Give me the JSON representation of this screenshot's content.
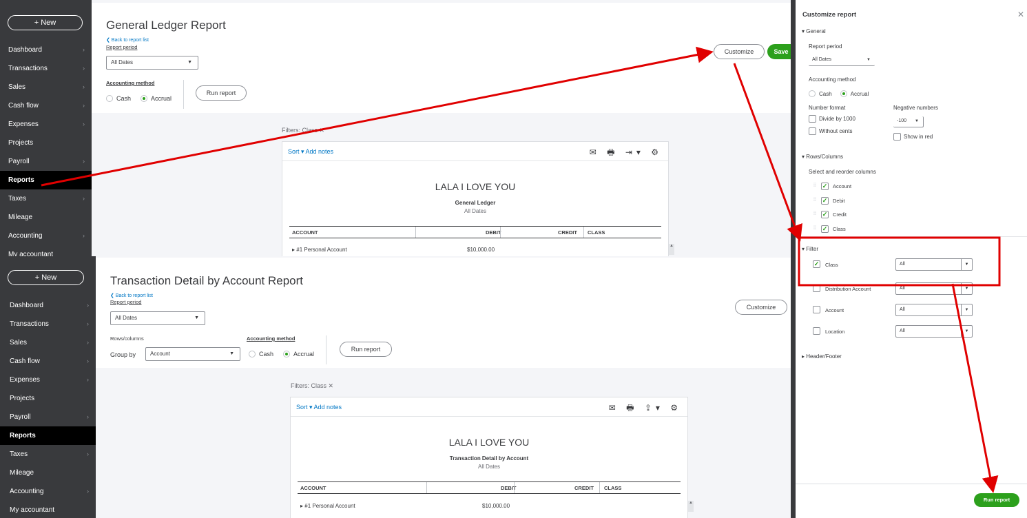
{
  "colors": {
    "sidebar": "#393a3d",
    "active_nav": "#000000",
    "accent_green": "#2ca01c",
    "link_blue": "#0077c5",
    "annotation_red": "#e00000"
  },
  "pane1": {
    "new_label": "+ New",
    "nav": [
      {
        "label": "Dashboard",
        "chev": true
      },
      {
        "label": "Transactions",
        "chev": true
      },
      {
        "label": "Sales",
        "chev": true
      },
      {
        "label": "Cash flow",
        "chev": true
      },
      {
        "label": "Expenses",
        "chev": true
      },
      {
        "label": "Projects",
        "chev": false
      },
      {
        "label": "Payroll",
        "chev": true
      },
      {
        "label": "Reports",
        "chev": false,
        "active": true
      },
      {
        "label": "Taxes",
        "chev": true
      },
      {
        "label": "Mileage",
        "chev": false
      },
      {
        "label": "Accounting",
        "chev": true
      },
      {
        "label": "My accountant",
        "chev": false
      }
    ],
    "title": "General Ledger Report",
    "back_link": "❮ Back to report list",
    "report_period_label": "Report period",
    "period_value": "All Dates",
    "accounting_method_label": "Accounting method",
    "cash_label": "Cash",
    "accrual_label": "Accrual",
    "run_report": "Run report",
    "customize": "Customize",
    "save": "Save",
    "filters": "Filters:  Class ✕",
    "sort": "Sort ▾   Add notes",
    "icons": "✉ 🖶 ⇥▾ ⚙",
    "company": "LALA I LOVE YOU",
    "report_name": "General Ledger",
    "report_dates": "All Dates",
    "columns": {
      "account": "ACCOUNT",
      "debit": "DEBIT",
      "credit": "CREDIT",
      "class": "CLASS"
    },
    "row": {
      "account": "▸ #1 Personal Account",
      "debit": "$10,000.00"
    }
  },
  "pane2": {
    "new_label": "+ New",
    "nav": [
      {
        "label": "Dashboard",
        "chev": true
      },
      {
        "label": "Transactions",
        "chev": true
      },
      {
        "label": "Sales",
        "chev": true
      },
      {
        "label": "Cash flow",
        "chev": true
      },
      {
        "label": "Expenses",
        "chev": true
      },
      {
        "label": "Projects",
        "chev": false
      },
      {
        "label": "Payroll",
        "chev": true
      },
      {
        "label": "Reports",
        "chev": false,
        "active": true
      },
      {
        "label": "Taxes",
        "chev": true
      },
      {
        "label": "Mileage",
        "chev": false
      },
      {
        "label": "Accounting",
        "chev": true
      },
      {
        "label": "My accountant",
        "chev": false
      }
    ],
    "title": "Transaction Detail by Account Report",
    "back_link": "❮ Back to report list",
    "report_period_label": "Report period",
    "period_value": "All Dates",
    "rows_columns_label": "Rows/columns",
    "group_by_label": "Group by",
    "group_by_value": "Account",
    "accounting_method_label": "Accounting method",
    "cash_label": "Cash",
    "accrual_label": "Accrual",
    "run_report": "Run report",
    "customize": "Customize",
    "filters": "Filters:  Class ✕",
    "sort": "Sort ▾   Add notes",
    "icons": "✉ 🖶 ⇪▾ ⚙",
    "company": "LALA I LOVE YOU",
    "report_name": "Transaction Detail by Account",
    "report_dates": "All Dates",
    "columns": {
      "account": "ACCOUNT",
      "debit": "DEBIT",
      "credit": "CREDIT",
      "class": "CLASS"
    },
    "row": {
      "account": "▸ #1 Personal Account",
      "debit": "$10,000.00"
    }
  },
  "panel": {
    "title": "Customize report",
    "close": "✕",
    "general": "▾ General",
    "report_period": "Report period",
    "period_value": "All Dates",
    "accounting_method": "Accounting method",
    "cash": "Cash",
    "accrual": "Accrual",
    "number_format": "Number format",
    "divide_1000": "Divide by 1000",
    "without_cents": "Without cents",
    "negative_numbers": "Negative numbers",
    "negative_value": "-100",
    "show_in_red": "Show in red",
    "rows_columns": "▾ Rows/Columns",
    "select_reorder": "Select and reorder columns",
    "columns": [
      "Account",
      "Debit",
      "Credit",
      "Class"
    ],
    "filter": "▾ Filter",
    "filters": [
      {
        "label": "Class",
        "checked": true,
        "value": "All"
      },
      {
        "label": "Distribution Account",
        "checked": false,
        "value": "All"
      },
      {
        "label": "Account",
        "checked": false,
        "value": "All"
      },
      {
        "label": "Location",
        "checked": false,
        "value": "All"
      }
    ],
    "header_footer": "▸ Header/Footer",
    "run_report": "Run report"
  }
}
